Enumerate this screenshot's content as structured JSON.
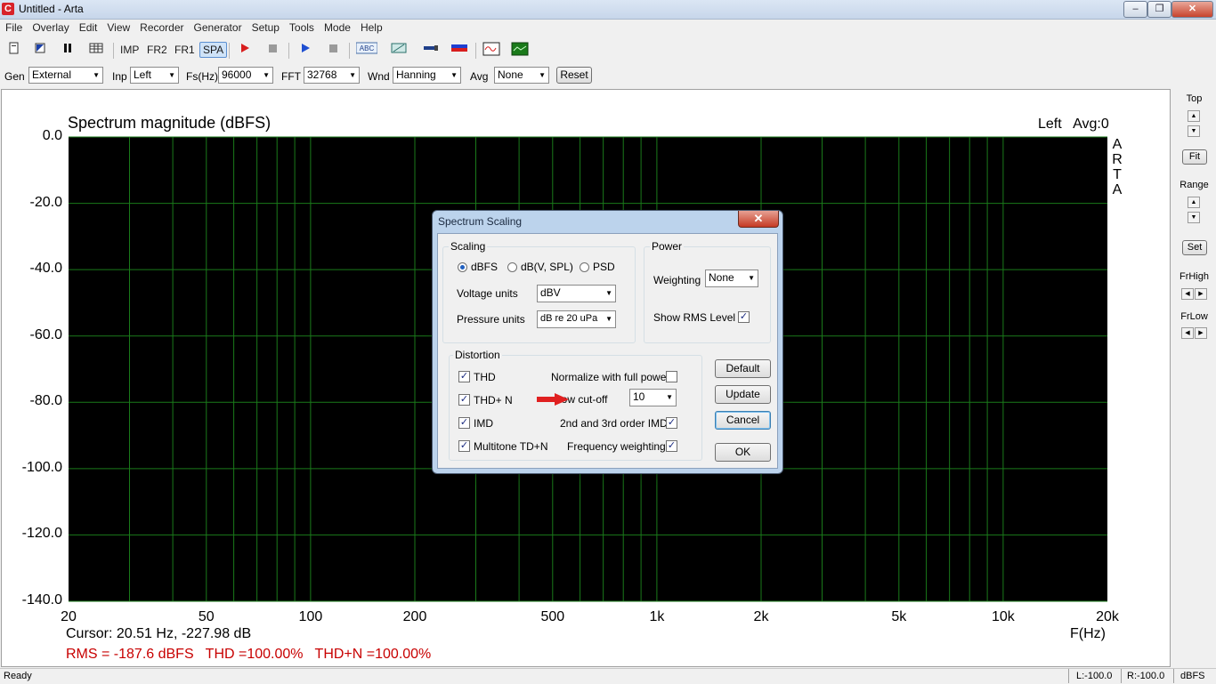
{
  "window": {
    "title": "Untitled - Arta",
    "app_icon_letter": "C",
    "minimize": "‒",
    "maximize": "❐",
    "close": "✕"
  },
  "menu": [
    "File",
    "Overlay",
    "Edit",
    "View",
    "Recorder",
    "Generator",
    "Setup",
    "Tools",
    "Mode",
    "Help"
  ],
  "toolbar": {
    "imp": "IMP",
    "fr2": "FR2",
    "fr1": "FR1",
    "spa": "SPA",
    "abc": "ABC"
  },
  "settings": {
    "gen_label": "Gen",
    "gen_value": "External",
    "inp_label": "Inp",
    "inp_value": "Left",
    "fs_label": "Fs(Hz)",
    "fs_value": "96000",
    "fft_label": "FFT",
    "fft_value": "32768",
    "wnd_label": "Wnd",
    "wnd_value": "Hanning",
    "avg_label": "Avg",
    "avg_value": "None",
    "reset_label": "Reset"
  },
  "chart": {
    "title": "Spectrum magnitude (dBFS)",
    "status": "Left   Avg:0",
    "logo": [
      "A",
      "R",
      "T",
      "A"
    ],
    "x_unit": "F(Hz)",
    "cursor": "Cursor: 20.51 Hz, -227.98 dB",
    "rms": "RMS = -187.6 dBFS   THD =100.00%   THD+N =100.00%",
    "colors": {
      "background": "#000000",
      "grid": "#1a7a1a"
    }
  },
  "chart_data": {
    "type": "line",
    "title": "Spectrum magnitude (dBFS)",
    "xlabel": "F(Hz)",
    "ylabel": "",
    "x_scale": "log",
    "xlim": [
      20,
      20000
    ],
    "ylim": [
      -140,
      0
    ],
    "x_ticks": [
      {
        "value": 20,
        "label": "20"
      },
      {
        "value": 50,
        "label": "50"
      },
      {
        "value": 100,
        "label": "100"
      },
      {
        "value": 200,
        "label": "200"
      },
      {
        "value": 500,
        "label": "500"
      },
      {
        "value": 1000,
        "label": "1k"
      },
      {
        "value": 2000,
        "label": "2k"
      },
      {
        "value": 5000,
        "label": "5k"
      },
      {
        "value": 10000,
        "label": "10k"
      },
      {
        "value": 20000,
        "label": "20k"
      }
    ],
    "y_ticks": [
      {
        "value": 0,
        "label": "0.0"
      },
      {
        "value": -20,
        "label": "-20.0"
      },
      {
        "value": -40,
        "label": "-40.0"
      },
      {
        "value": -60,
        "label": "-60.0"
      },
      {
        "value": -80,
        "label": "-80.0"
      },
      {
        "value": -100,
        "label": "-100.0"
      },
      {
        "value": -120,
        "label": "-120.0"
      },
      {
        "value": -140,
        "label": "-140.0"
      }
    ],
    "series": [],
    "grid": true
  },
  "right_panel": {
    "top": "Top",
    "fit": "Fit",
    "range": "Range",
    "set": "Set",
    "frhigh": "FrHigh",
    "frlow": "FrLow"
  },
  "status": {
    "text": "Ready",
    "l": "L:-100.0",
    "r": "R:-100.0",
    "unit": "dBFS"
  },
  "dialog": {
    "title": "Spectrum Scaling",
    "close": "✕",
    "scaling": {
      "title": "Scaling",
      "radio_dbfs": "dBFS",
      "radio_dbv": "dB(V, SPL)",
      "radio_psd": "PSD",
      "selected": "dBFS",
      "voltage_label": "Voltage units",
      "voltage_value": "dBV",
      "pressure_label": "Pressure units",
      "pressure_value": "dB re 20 uPa"
    },
    "power": {
      "title": "Power",
      "weighting_label": "Weighting",
      "weighting_value": "None",
      "show_rms_label": "Show RMS Level",
      "show_rms_checked": true
    },
    "distortion": {
      "title": "Distortion",
      "thd": "THD",
      "thdn": "THD+ N",
      "imd": "IMD",
      "multitone": "Multitone TD+N",
      "normalize": "Normalize with full power",
      "low_cutoff": "Low cut-off",
      "low_cutoff_value": "10",
      "imd_order": "2nd and 3rd order IMD",
      "freq_weighting": "Frequency weighting",
      "thd_checked": true,
      "thdn_checked": true,
      "imd_checked": true,
      "multitone_checked": true,
      "normalize_checked": false,
      "imd_order_checked": true,
      "freq_weighting_checked": true
    },
    "buttons": {
      "default": "Default",
      "update": "Update",
      "cancel": "Cancel",
      "ok": "OK"
    },
    "arrow_color": "#e02020"
  }
}
